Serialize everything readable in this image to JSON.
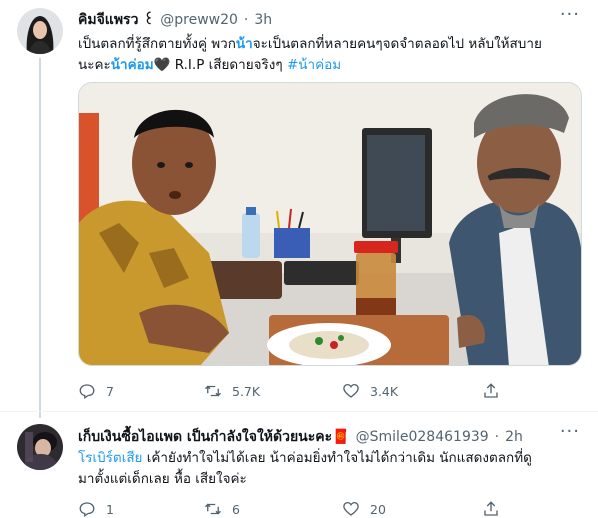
{
  "tweet1": {
    "display_name": "คิมจีแพรว ꒰",
    "handle": "@preww20",
    "sep": "·",
    "time": "3h",
    "text_line1_a": "เป็นตลกที่รู้สึกตายทั้งคู่ พวก",
    "text_line1_bold": "น้า",
    "text_line1_b": "จะเป็นตลกที่หลายคนๆจดจำตลอดไป หลับให้สบาย",
    "text_line2_a": "นะคะ",
    "text_line2_bold": "น้าค่อม",
    "text_line2_heart": "🖤",
    "text_line2_b": " R.I.P เสียดายจริงๆ ",
    "hashtag": "#น้าค่อม",
    "counts": {
      "reply": "7",
      "retweet": "5.7K",
      "like": "3.4K"
    }
  },
  "tweet2": {
    "display_name": "เก็บเงินซื้อไอแพด เป็นกำลังใจให้ด้วยนะคะ🧧",
    "handle": "@Smile028461939",
    "sep": "·",
    "time": "2h",
    "text_line1_hl": "โรเบิร์ตเสีย",
    "text_line1_rest": " เค้ายังทำใจไม่ได้เลย น้าค่อมยิ่งทำใจไม่ได้กว่าเดิม   นักแสดงตลกที่ดู",
    "text_line2": "มาตั้งแต่เด็กเลย หื้อ เสียใจค่ะ",
    "counts": {
      "reply": "1",
      "retweet": "6",
      "like": "20"
    }
  },
  "icons": {
    "reply": "reply-icon",
    "retweet": "retweet-icon",
    "like": "heart-icon",
    "share": "share-icon",
    "more": "more-icon"
  },
  "colors": {
    "link": "#1d9bf0",
    "muted": "#536471",
    "text": "#0f1419"
  }
}
